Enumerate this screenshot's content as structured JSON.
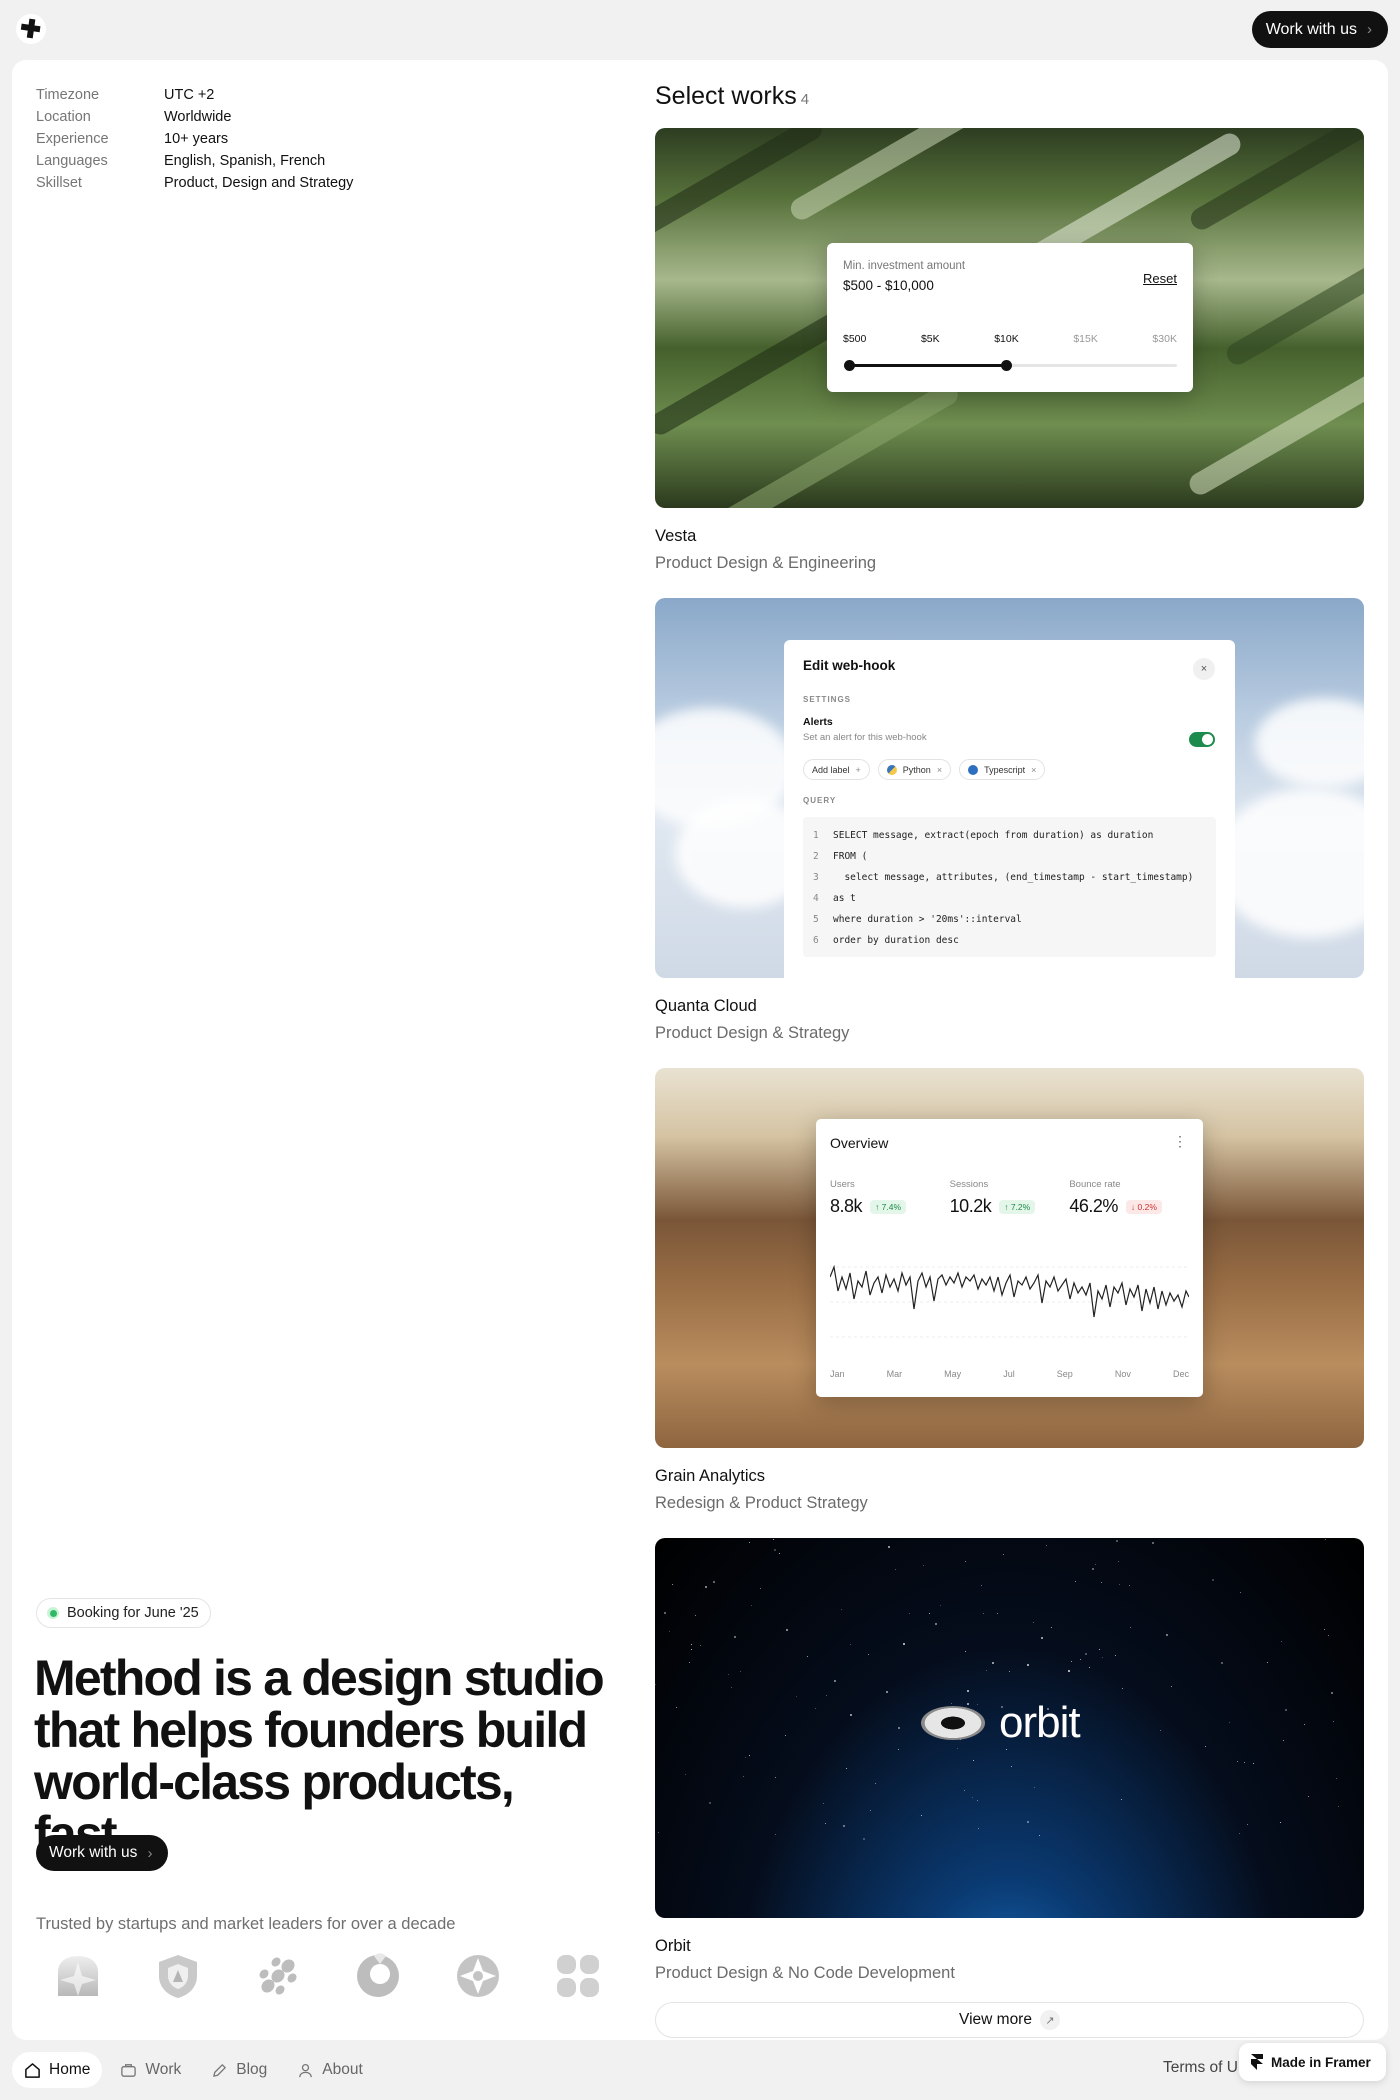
{
  "topbar": {
    "cta_label": "Work with us",
    "cta_chevron": "›"
  },
  "profile": {
    "rows": [
      {
        "key": "Timezone",
        "value": "UTC +2"
      },
      {
        "key": "Location",
        "value": "Worldwide"
      },
      {
        "key": "Experience",
        "value": "10+ years"
      },
      {
        "key": "Languages",
        "value": "English, Spanish, French"
      },
      {
        "key": "Skillset",
        "value": "Product, Design and Strategy"
      }
    ]
  },
  "hero": {
    "booking_label": "Booking for June '25",
    "headline": "Method is a design studio that helps founders build world-class products, fast.",
    "cta_label": "Work with us",
    "cta_chevron": "›",
    "trusted_text": "Trusted by startups and market leaders for over a decade",
    "logo_icons": [
      "star-tile-icon",
      "shield-icon",
      "chain-icon",
      "ring-icon",
      "compass-star-icon",
      "quad-icon"
    ]
  },
  "works": {
    "title": "Select works",
    "count": "4",
    "items": [
      {
        "name": "Vesta",
        "category": "Product Design & Engineering",
        "mock": {
          "label": "Min. investment amount",
          "range": "$500 - $10,000",
          "reset": "Reset",
          "ticks": [
            "$500",
            "$5K",
            "$10K",
            "$15K",
            "$30K"
          ],
          "slider_max_fraction": 0.48
        }
      },
      {
        "name": "Quanta Cloud",
        "category": "Product Design & Strategy",
        "mock": {
          "title": "Edit web-hook",
          "close": "×",
          "settings": "SETTINGS",
          "alerts": "Alerts",
          "alerts_sub": "Set an alert for this web-hook",
          "chips": [
            {
              "label": "Add label",
              "action": "+"
            },
            {
              "label": "Python",
              "action": "×"
            },
            {
              "label": "Typescript",
              "action": "×"
            }
          ],
          "query": "QUERY",
          "code": [
            {
              "n": "1",
              "line": "SELECT message, extract(epoch from duration) as duration"
            },
            {
              "n": "2",
              "line": "FROM ("
            },
            {
              "n": "3",
              "line": "  select message, attributes, (end_timestamp - start_timestamp)"
            },
            {
              "n": "4",
              "line": "as t"
            },
            {
              "n": "5",
              "line": "where duration > '20ms'::interval"
            },
            {
              "n": "6",
              "line": "order by duration desc"
            }
          ]
        }
      },
      {
        "name": "Grain Analytics",
        "category": "Redesign & Product Strategy",
        "mock": {
          "title": "Overview",
          "more": "⋮",
          "stats": [
            {
              "label": "Users",
              "value": "8.8k",
              "delta": "↑ 7.4%",
              "dir": "up"
            },
            {
              "label": "Sessions",
              "value": "10.2k",
              "delta": "↑ 7.2%",
              "dir": "up"
            },
            {
              "label": "Bounce rate",
              "value": "46.2%",
              "delta": "↓ 0.2%",
              "dir": "down"
            }
          ],
          "months": [
            "Jan",
            "Mar",
            "May",
            "Jul",
            "Sep",
            "Nov",
            "Dec"
          ]
        }
      },
      {
        "name": "Orbit",
        "category": "Product Design & No Code Development",
        "mock": {
          "wordmark": "orbit"
        }
      }
    ],
    "view_more": "View more",
    "view_more_icon": "↗"
  },
  "bottom_nav": {
    "items": [
      {
        "label": "Home",
        "icon": "home-icon",
        "active": true
      },
      {
        "label": "Work",
        "icon": "briefcase-icon",
        "active": false
      },
      {
        "label": "Blog",
        "icon": "pen-icon",
        "active": false
      },
      {
        "label": "About",
        "icon": "user-icon",
        "active": false
      }
    ],
    "terms": "Terms of U",
    "framer_badge": "Made in Framer"
  }
}
